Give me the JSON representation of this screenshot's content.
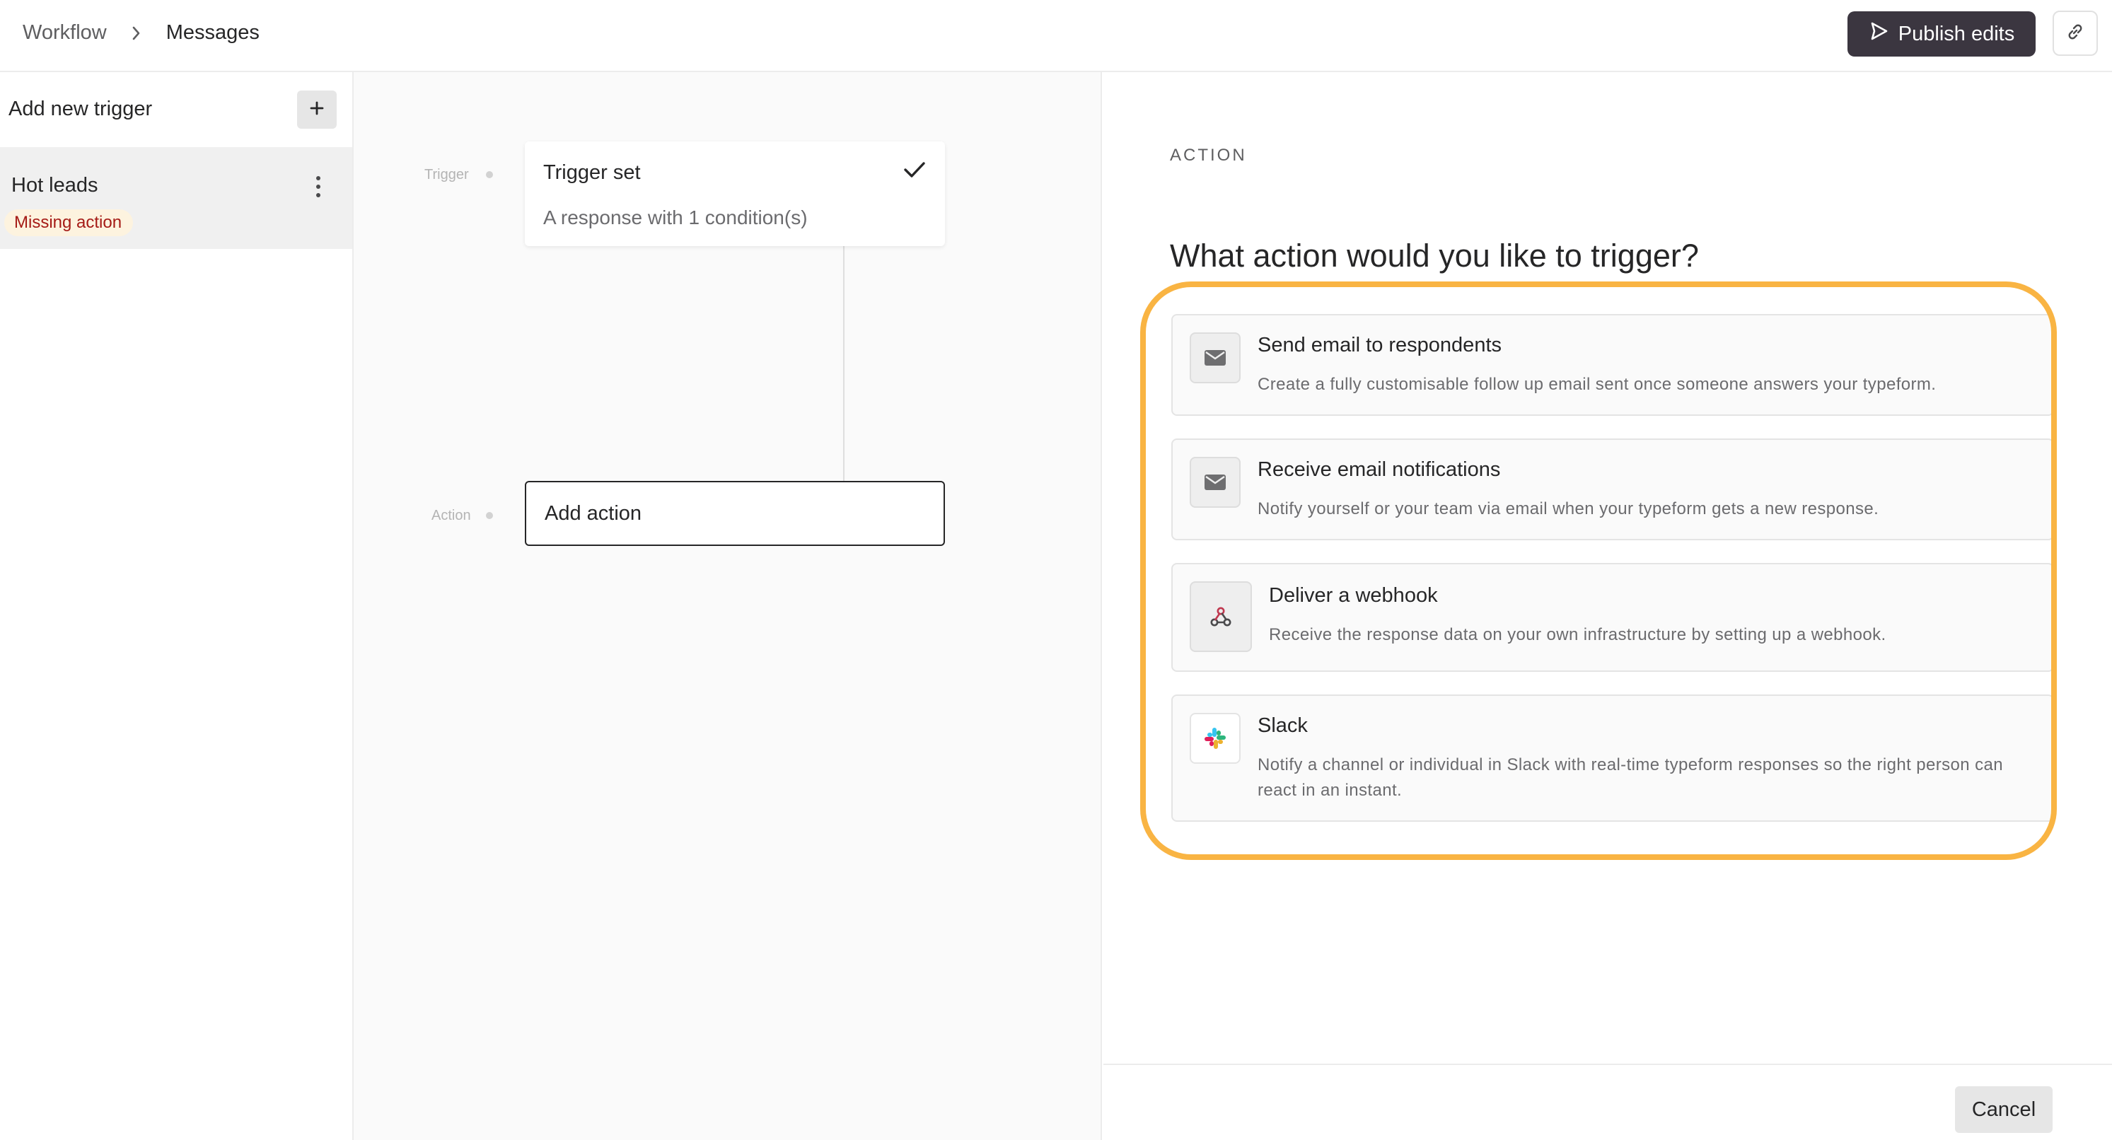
{
  "breadcrumb": {
    "parent": "Workflow",
    "current": "Messages"
  },
  "header": {
    "publish_label": "Publish edits",
    "publish_color": "#3b3640"
  },
  "sidebar": {
    "heading": "Add new trigger",
    "items": [
      {
        "name": "Hot leads",
        "badge": "Missing action"
      }
    ]
  },
  "canvas": {
    "trigger_label": "Trigger",
    "action_label": "Action",
    "trigger_card": {
      "title": "Trigger set",
      "subtitle": "A response with 1 condition(s)"
    },
    "action_card": {
      "label": "Add action"
    }
  },
  "panel": {
    "section": "ACTION",
    "title": "What action would you like to trigger?",
    "highlight_color": "#f9b443",
    "options": [
      {
        "title": "Send email to respondents",
        "description": "Create a fully customisable follow up email sent once someone answers your typeform.",
        "icon": "mail-icon"
      },
      {
        "title": "Receive email notifications",
        "description": "Notify yourself or your team via email when your typeform gets a new response.",
        "icon": "mail-icon"
      },
      {
        "title": "Deliver a webhook",
        "description": "Receive the response data on your own infrastructure by setting up a webhook.",
        "icon": "webhook-icon"
      },
      {
        "title": "Slack",
        "description": "Notify a channel or individual in Slack with real-time typeform responses so the right person can react in an instant.",
        "icon": "slack-icon"
      }
    ],
    "cancel_label": "Cancel"
  }
}
